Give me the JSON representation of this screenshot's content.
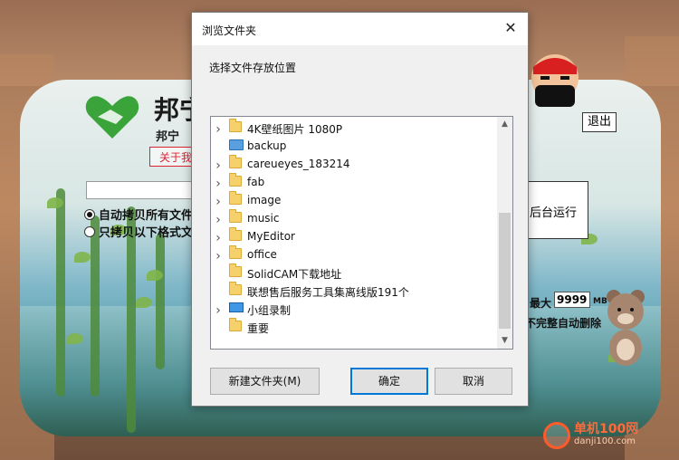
{
  "app": {
    "logo_text": "邦宁",
    "logo_sub": "邦宁",
    "about_label": "关于我",
    "radio_all_label": "自动拷贝所有文件",
    "radio_ext_label": "只拷贝以下格式文",
    "exit_label": "退出",
    "bg_run_label": "后台运行",
    "max_label": "最大",
    "max_value": "9999",
    "mb_label": "MB",
    "auto_delete_label": "不完整自动删除"
  },
  "dialog": {
    "title": "浏览文件夹",
    "description": "选择文件存放位置",
    "close_glyph": "✕",
    "items": [
      {
        "label": "4K壁纸图片 1080P",
        "icon": "folder-icon",
        "expandable": true
      },
      {
        "label": "backup",
        "icon": "network-folder-icon",
        "expandable": false
      },
      {
        "label": "careueyes_183214",
        "icon": "folder-icon",
        "expandable": true
      },
      {
        "label": "fab",
        "icon": "folder-icon",
        "expandable": true
      },
      {
        "label": "image",
        "icon": "folder-icon",
        "expandable": true
      },
      {
        "label": "music",
        "icon": "folder-icon",
        "expandable": true
      },
      {
        "label": "MyEditor",
        "icon": "folder-icon",
        "expandable": true
      },
      {
        "label": "office",
        "icon": "folder-icon",
        "expandable": true
      },
      {
        "label": "SolidCAM下载地址",
        "icon": "folder-icon",
        "expandable": false
      },
      {
        "label": "联想售后服务工具集离线版191个",
        "icon": "folder-icon",
        "expandable": false
      },
      {
        "label": "小组录制",
        "icon": "pc-icon",
        "expandable": true
      },
      {
        "label": "重要",
        "icon": "folder-icon",
        "expandable": false
      }
    ],
    "buttons": {
      "new_folder": "新建文件夹(M)",
      "ok": "确定",
      "cancel": "取消"
    }
  },
  "watermark": {
    "name": "单机100网",
    "url": "danji100.com"
  }
}
